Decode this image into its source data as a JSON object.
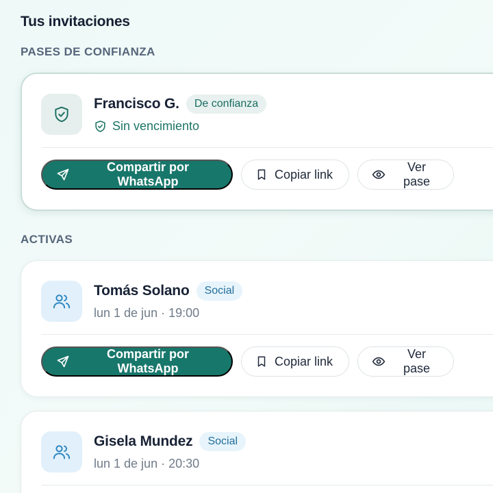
{
  "page": {
    "title": "Tus invitaciones"
  },
  "sections": {
    "trusted": {
      "label": "PASES DE CONFIANZA"
    },
    "active": {
      "label": "ACTIVAS"
    }
  },
  "trusted_cards": [
    {
      "name": "Francisco G.",
      "badge": "De confianza",
      "subtitle": "Sin vencimiento",
      "actions": {
        "share": "Compartir por WhatsApp",
        "copy": "Copiar link",
        "view": "Ver pase"
      }
    }
  ],
  "active_cards": [
    {
      "name": "Tomás Solano",
      "badge": "Social",
      "subtitle": "lun 1 de jun · 19:00",
      "actions": {
        "share": "Compartir por WhatsApp",
        "copy": "Copiar link",
        "view": "Ver pase"
      }
    },
    {
      "name": "Gisela Mundez",
      "badge": "Social",
      "subtitle": "lun 1 de jun · 20:30"
    }
  ],
  "colors": {
    "primary": "#18776b",
    "trusted_badge_text": "#1a6d62",
    "social_badge_text": "#236f9a",
    "title_text": "#152033"
  },
  "icons": {
    "trusted_avatar": "shield-check-icon",
    "active_avatar": "users-icon",
    "share": "send-icon",
    "copy": "bookmark-icon",
    "view": "eye-icon"
  }
}
